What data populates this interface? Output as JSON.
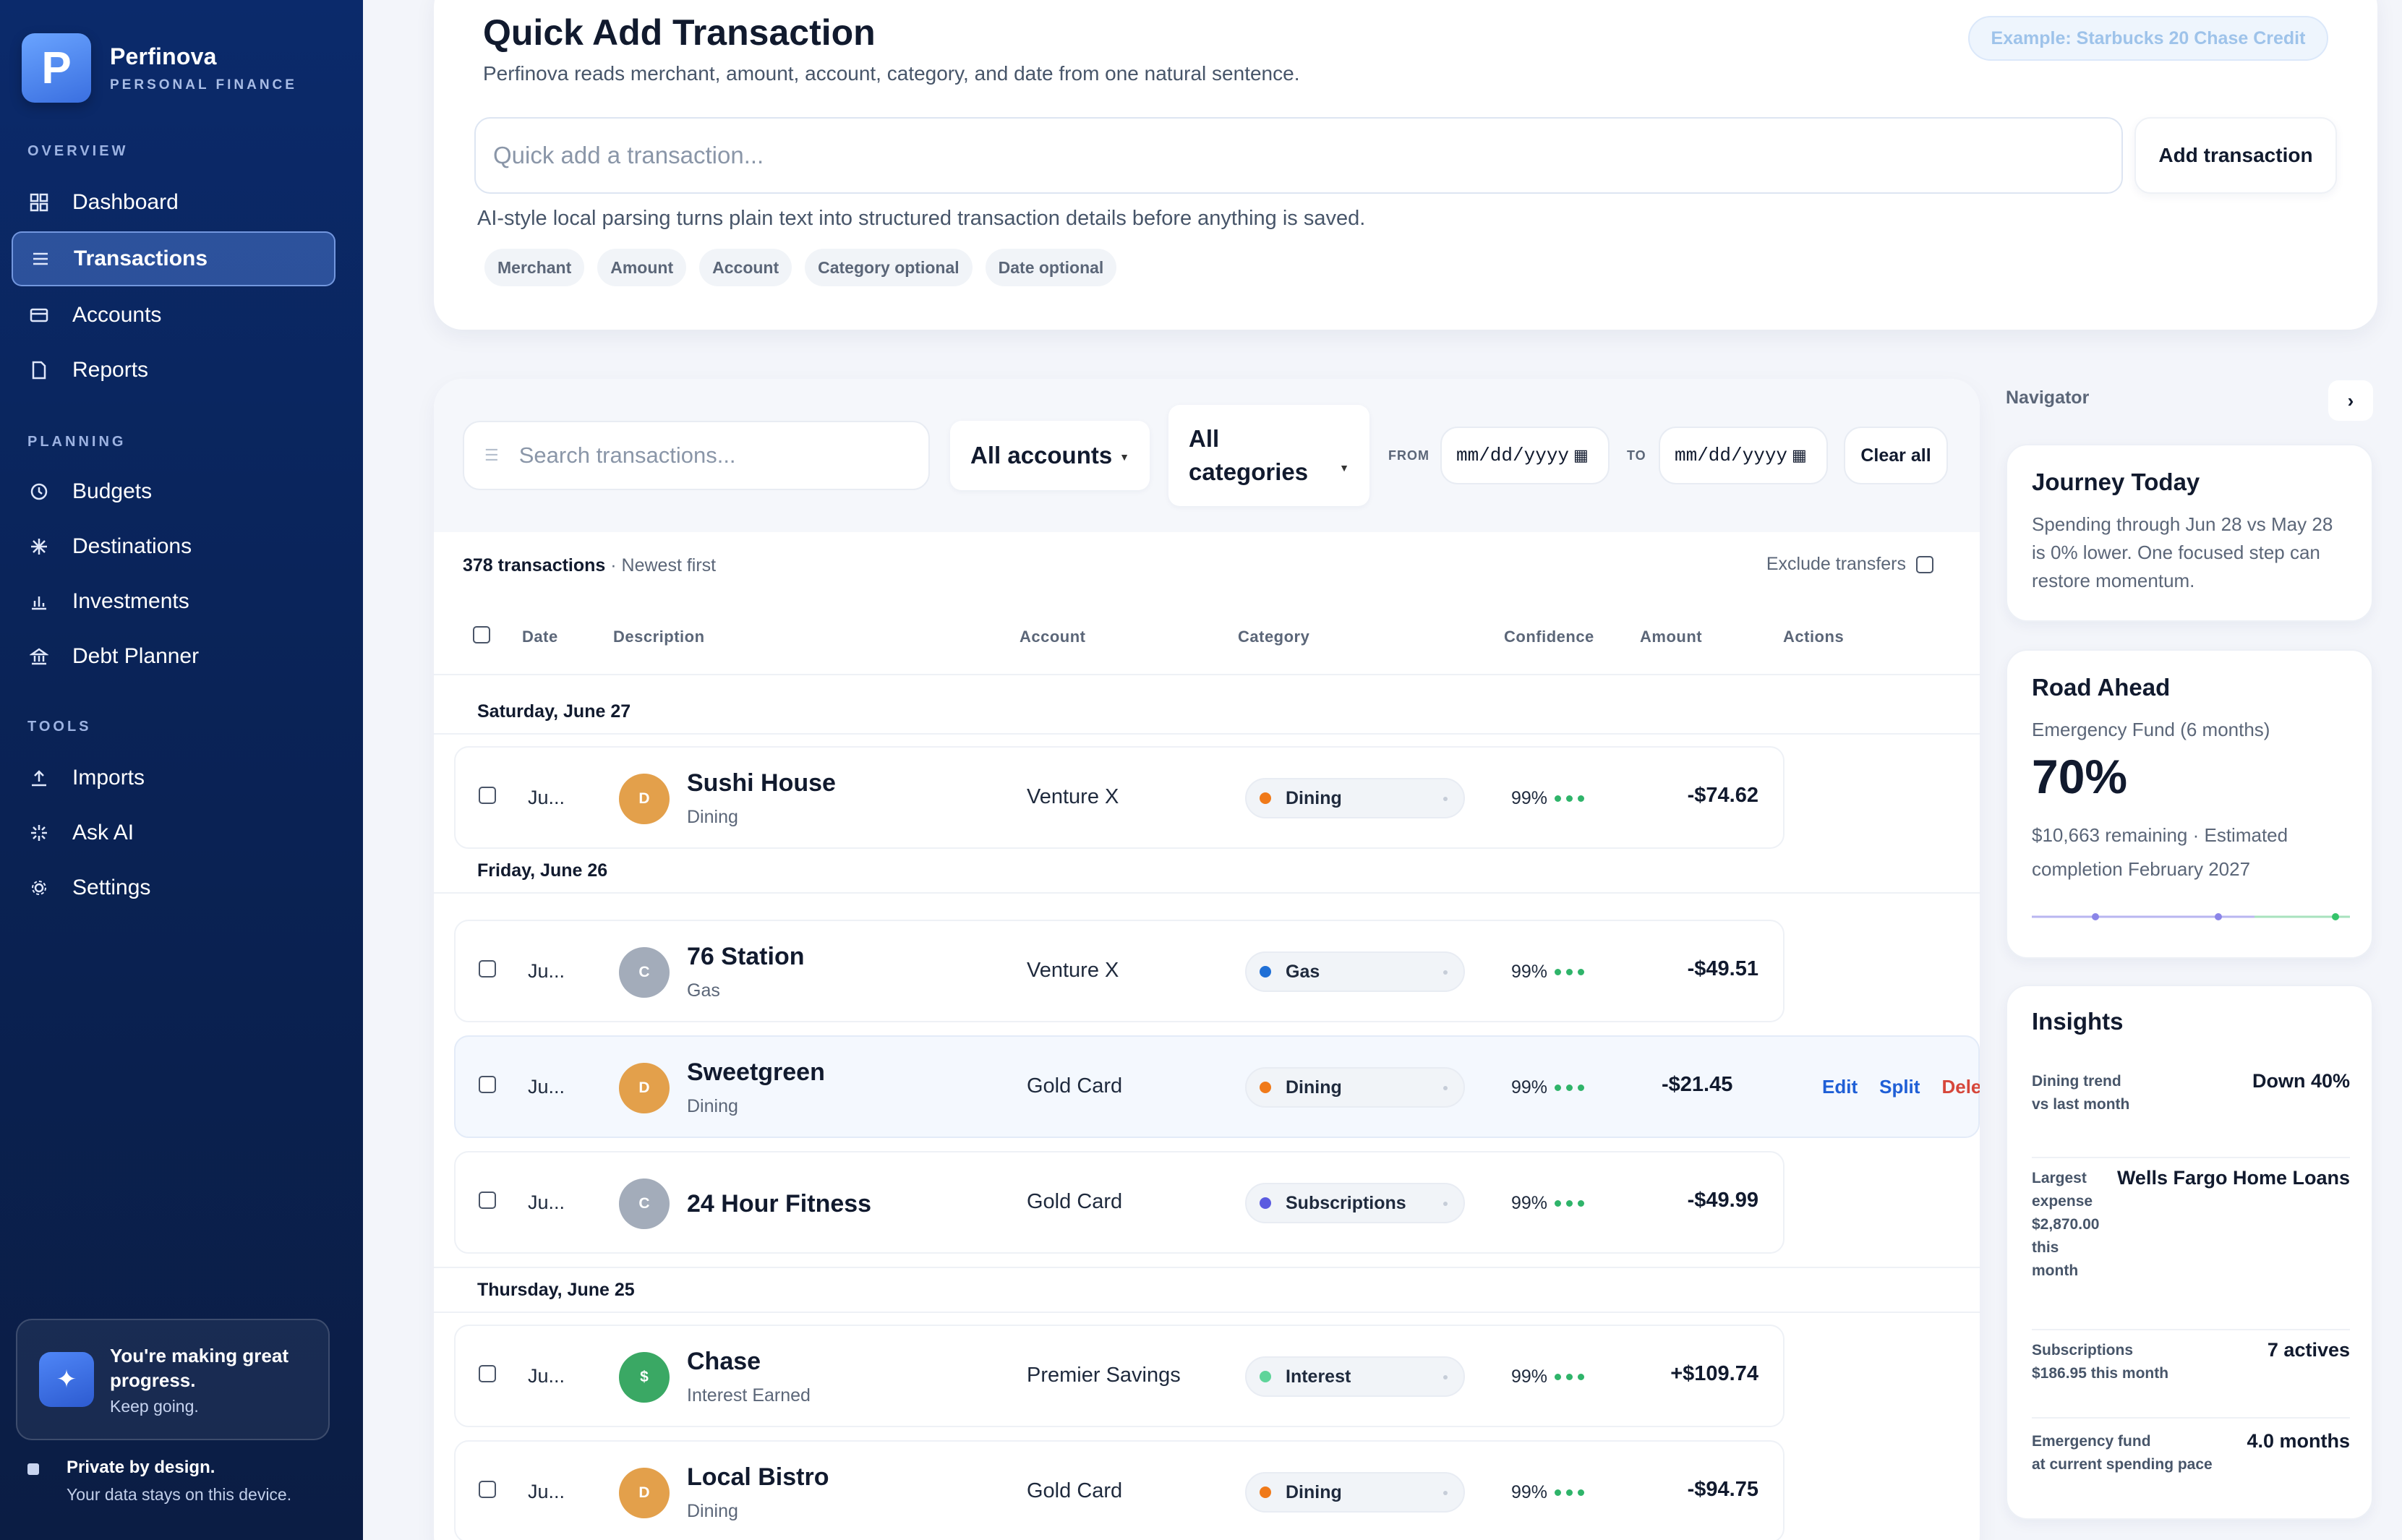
{
  "brand": {
    "logo_letter": "P",
    "name": "Perfinova",
    "subtitle": "PERSONAL FINANCE"
  },
  "sidebar": {
    "sections": [
      {
        "title": "OVERVIEW",
        "items": [
          {
            "label": "Dashboard",
            "icon": "grid-icon"
          },
          {
            "label": "Transactions",
            "icon": "list-icon",
            "active": true
          },
          {
            "label": "Accounts",
            "icon": "card-icon"
          },
          {
            "label": "Reports",
            "icon": "document-icon"
          }
        ]
      },
      {
        "title": "PLANNING",
        "items": [
          {
            "label": "Budgets",
            "icon": "clock-icon"
          },
          {
            "label": "Destinations",
            "icon": "sparkle-icon"
          },
          {
            "label": "Investments",
            "icon": "bar-chart-icon"
          },
          {
            "label": "Debt Planner",
            "icon": "bank-icon"
          }
        ]
      },
      {
        "title": "TOOLS",
        "items": [
          {
            "label": "Imports",
            "icon": "upload-icon"
          },
          {
            "label": "Ask AI",
            "icon": "spark-icon"
          },
          {
            "label": "Settings",
            "icon": "gear-icon"
          }
        ]
      }
    ],
    "progress": {
      "title": "You're making great progress.",
      "subtitle": "Keep going."
    },
    "privacy": {
      "title": "Private by design.",
      "subtitle": "Your data stays on this device."
    }
  },
  "quick_add": {
    "title": "Quick Add Transaction",
    "subtitle": "Perfinova reads merchant, amount, account, category, and date from one natural sentence.",
    "example": "Example: Starbucks 20 Chase Credit",
    "placeholder": "Quick add a transaction...",
    "button": "Add transaction",
    "hint": "AI-style local parsing turns plain text into structured transaction details before anything is saved.",
    "chips": [
      "Merchant",
      "Amount",
      "Account",
      "Category optional",
      "Date optional"
    ]
  },
  "filters": {
    "search_placeholder": "Search transactions...",
    "account": "All accounts",
    "category_line1": "All",
    "category_line2": "categories",
    "from_label": "FROM",
    "to_label": "TO",
    "date_placeholder": "mm/dd/yyyy",
    "clear": "Clear all"
  },
  "list": {
    "count": "378 transactions",
    "sort": " · Newest first",
    "exclude_transfers": "Exclude transfers",
    "columns": [
      "Date",
      "Description",
      "Account",
      "Category",
      "Confidence",
      "Amount",
      "Actions"
    ]
  },
  "days": [
    {
      "label": "Saturday, June 27"
    },
    {
      "label": "Friday, June 26"
    },
    {
      "label": "Thursday, June 25"
    }
  ],
  "transactions": [
    {
      "date": "Ju...",
      "initial": "D",
      "avatar_color": "#e3a04b",
      "merchant": "Sushi House",
      "sub": "Dining",
      "account": "Venture X",
      "category": "Dining",
      "cat_color": "#f07a1a",
      "confidence": "99%",
      "amount": "-$74.62"
    },
    {
      "date": "Ju...",
      "initial": "C",
      "avatar_color": "#a3acba",
      "merchant": "76 Station",
      "sub": "Gas",
      "account": "Venture X",
      "category": "Gas",
      "cat_color": "#1f6fd6",
      "confidence": "99%",
      "amount": "-$49.51"
    },
    {
      "date": "Ju...",
      "initial": "D",
      "avatar_color": "#e3a04b",
      "merchant": "Sweetgreen",
      "sub": "Dining",
      "account": "Gold Card",
      "category": "Dining",
      "cat_color": "#f07a1a",
      "confidence": "99%",
      "amount": "-$21.45"
    },
    {
      "date": "Ju...",
      "initial": "C",
      "avatar_color": "#a3acba",
      "merchant": "24 Hour Fitness",
      "sub": "",
      "account": "Gold Card",
      "category": "Subscriptions",
      "cat_color": "#5b5be0",
      "confidence": "99%",
      "amount": "-$49.99"
    },
    {
      "date": "Ju...",
      "initial": "$",
      "avatar_color": "#3aa864",
      "merchant": "Chase",
      "sub": "Interest Earned",
      "account": "Premier Savings",
      "category": "Interest",
      "cat_color": "#5fd49a",
      "confidence": "99%",
      "amount": "+$109.74"
    },
    {
      "date": "Ju...",
      "initial": "D",
      "avatar_color": "#e3a04b",
      "merchant": "Local Bistro",
      "sub": "Dining",
      "account": "Gold Card",
      "category": "Dining",
      "cat_color": "#f07a1a",
      "confidence": "99%",
      "amount": "-$94.75"
    }
  ],
  "row_actions": {
    "edit": "Edit",
    "split": "Split",
    "delete": "Delete"
  },
  "navigator": {
    "title": "Navigator",
    "toggle": "›",
    "journey": {
      "title": "Journey Today",
      "body": "Spending through Jun 28 vs May 28 is 0% lower. One focused step can restore momentum."
    },
    "road": {
      "title": "Road Ahead",
      "goal": "Emergency Fund (6 months)",
      "percent": "70%",
      "progress": 0.7,
      "detail": "$10,663 remaining · Estimated completion February 2027"
    },
    "insights": {
      "title": "Insights",
      "rows": [
        {
          "label": "Dining trend\nvs last month",
          "value": "Down 40%"
        },
        {
          "label": "Largest\nexpense\n$2,870.00\nthis\nmonth",
          "value": "Wells Fargo Home Loans"
        },
        {
          "label": "Subscriptions\n$186.95 this month",
          "value": "7 actives"
        },
        {
          "label": "Emergency fund\nat current spending pace",
          "value": "4.0 months"
        }
      ]
    }
  },
  "colors": {
    "sidebar": "#0b2a6b",
    "accent": "#1f5fd6",
    "delete": "#d6473b",
    "positive": "#2fb46a"
  }
}
